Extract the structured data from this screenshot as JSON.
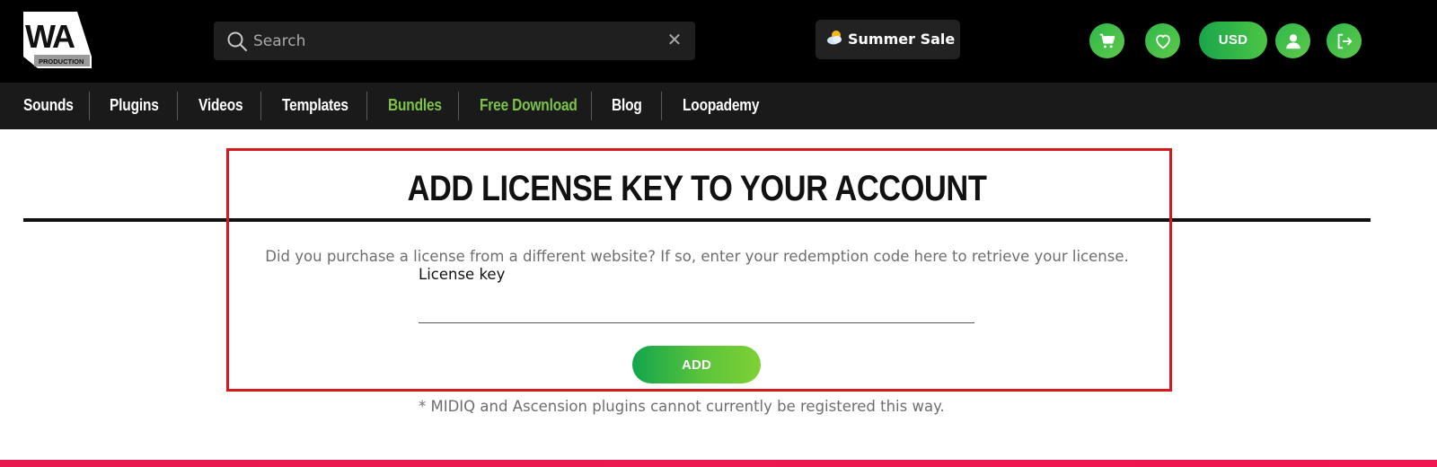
{
  "brand": {
    "logo_text": "WA",
    "logo_subtext": "PRODUCTION"
  },
  "search": {
    "placeholder": "Search",
    "value": ""
  },
  "promo": {
    "label": "Summer Sale",
    "icon": "sun-cloud-icon"
  },
  "header_actions": {
    "cart_icon": "cart-icon",
    "wishlist_icon": "heart-icon",
    "currency": "USD",
    "account_icon": "user-icon",
    "logout_icon": "logout-icon"
  },
  "nav": {
    "items": [
      {
        "label": "Sounds"
      },
      {
        "label": "Plugins"
      },
      {
        "label": "Videos"
      },
      {
        "label": "Templates"
      },
      {
        "label": "Bundles",
        "highlight": true
      },
      {
        "label": "Free Download",
        "highlight": true
      },
      {
        "label": "Blog"
      },
      {
        "label": "Loopademy"
      }
    ]
  },
  "main": {
    "title": "ADD LICENSE KEY TO YOUR ACCOUNT",
    "description": "Did you purchase a license from a different website? If so, enter your redemption code here to retrieve your license.",
    "field_label": "License key",
    "field_value": "",
    "add_label": "ADD",
    "note": "* MIDIQ and Ascension plugins cannot currently be registered this way."
  },
  "colors": {
    "accent_green": "#4bc544",
    "nav_highlight": "#7dc34a",
    "highlight_box": "#d6191b",
    "footer_bar": "#e8194f"
  }
}
